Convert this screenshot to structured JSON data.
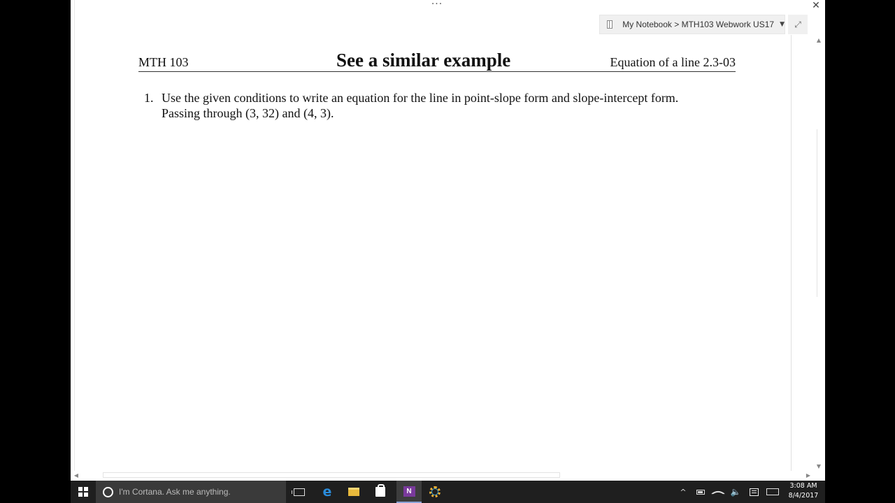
{
  "window": {
    "menu_dots": "···",
    "close_glyph": "✕"
  },
  "breadcrumb": {
    "text": "My Notebook > MTH103 Webwork US17",
    "dropdown_glyph": "▼",
    "expand_glyph": "⤢"
  },
  "document": {
    "course": "MTH 103",
    "title": "See a similar example",
    "section": "Equation of a line 2.3-03",
    "problem": {
      "number": "1.",
      "line1": "Use the given conditions to write an equation for the line in point-slope form and slope-intercept form.",
      "line2": "Passing through (3, 32) and (4, 3)."
    }
  },
  "scrollbars": {
    "up": "▲",
    "down": "▼",
    "left": "◀",
    "right": "▶"
  },
  "taskbar": {
    "cortana_placeholder": "I'm Cortana. Ask me anything.",
    "edge_glyph": "e",
    "onenote_glyph": "N",
    "tray_chevron": "^",
    "volume_glyph": "🔈",
    "clock_time": "3:08 AM",
    "clock_date": "8/4/2017"
  },
  "colors": {
    "taskbar_bg": "#1f1f1f",
    "onenote_purple": "#7a3a9c",
    "edge_blue": "#2a8cdb"
  }
}
